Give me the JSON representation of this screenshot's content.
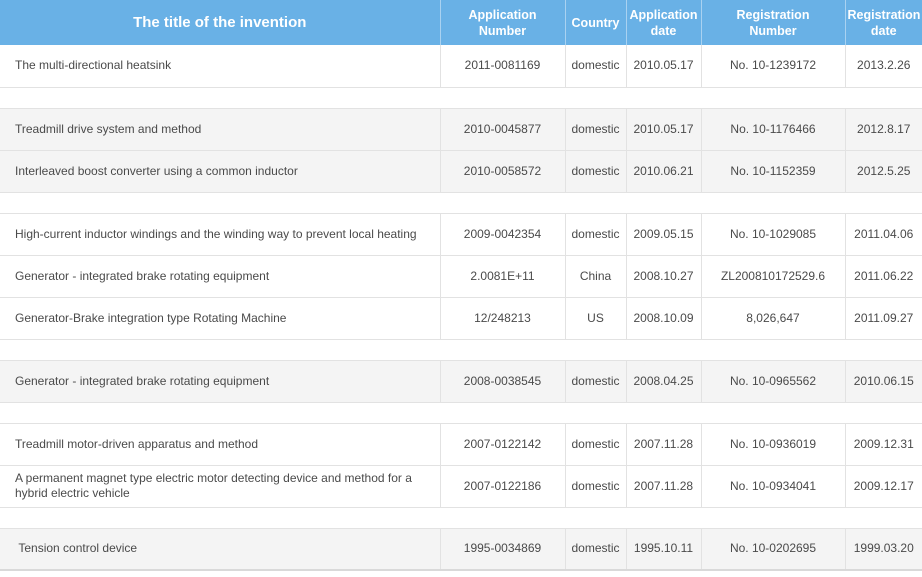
{
  "headers": {
    "title": "The title of the invention",
    "application_number": "Application\nNumber",
    "country": "Country",
    "application_date": "Application\ndate",
    "registration_number": "Registration\nNumber",
    "registration_date": "Registration\ndate"
  },
  "colors": {
    "header_bg": "#69b1e6",
    "header_text": "#ffffff",
    "shaded_row": "#f4f4f4",
    "border": "#e2e2e2"
  },
  "groups": [
    {
      "rows": [
        {
          "title": "The multi-directional heatsink",
          "application_number": "2011-0081169",
          "country": "domestic",
          "application_date": "2010.05.17",
          "registration_number": "No. 10-1239172",
          "registration_date": "2013.2.26"
        }
      ]
    },
    {
      "rows": [
        {
          "title": "Treadmill drive system and method",
          "application_number": "2010-0045877",
          "country": "domestic",
          "application_date": "2010.05.17",
          "registration_number": "No. 10-1176466",
          "registration_date": "2012.8.17"
        },
        {
          "title": "Interleaved boost converter using a common inductor",
          "application_number": "2010-0058572",
          "country": "domestic",
          "application_date": "2010.06.21",
          "registration_number": "No. 10-1152359",
          "registration_date": "2012.5.25"
        }
      ]
    },
    {
      "rows": [
        {
          "title": "High-current inductor windings and the winding way to prevent local heating",
          "application_number": "2009-0042354",
          "country": "domestic",
          "application_date": "2009.05.15",
          "registration_number": "No. 10-1029085",
          "registration_date": "2011.04.06"
        },
        {
          "title": "Generator - integrated brake rotating equipment",
          "application_number": "2.0081E+11",
          "country": "China",
          "application_date": "2008.10.27",
          "registration_number": "ZL200810172529.6",
          "registration_date": "2011.06.22"
        },
        {
          "title": "Generator-Brake integration type Rotating Machine",
          "application_number": "12/248213",
          "country": "US",
          "application_date": "2008.10.09",
          "registration_number": "8,026,647",
          "registration_date": "2011.09.27"
        }
      ]
    },
    {
      "rows": [
        {
          "title": "Generator - integrated brake rotating equipment",
          "application_number": "2008-0038545",
          "country": "domestic",
          "application_date": "2008.04.25",
          "registration_number": "No. 10-0965562",
          "registration_date": "2010.06.15"
        }
      ]
    },
    {
      "rows": [
        {
          "title": "Treadmill motor-driven apparatus and method",
          "application_number": "2007-0122142",
          "country": "domestic",
          "application_date": "2007.11.28",
          "registration_number": "No. 10-0936019",
          "registration_date": "2009.12.31"
        },
        {
          "title": "A permanent magnet type electric motor detecting device and method for a hybrid electric vehicle",
          "application_number": "2007-0122186",
          "country": "domestic",
          "application_date": "2007.11.28",
          "registration_number": "No. 10-0934041",
          "registration_date": "2009.12.17"
        }
      ]
    },
    {
      "rows": [
        {
          "title": " Tension control device",
          "application_number": "1995-0034869",
          "country": "domestic",
          "application_date": "1995.10.11",
          "registration_number": "No. 10-0202695",
          "registration_date": "1999.03.20"
        }
      ]
    }
  ]
}
